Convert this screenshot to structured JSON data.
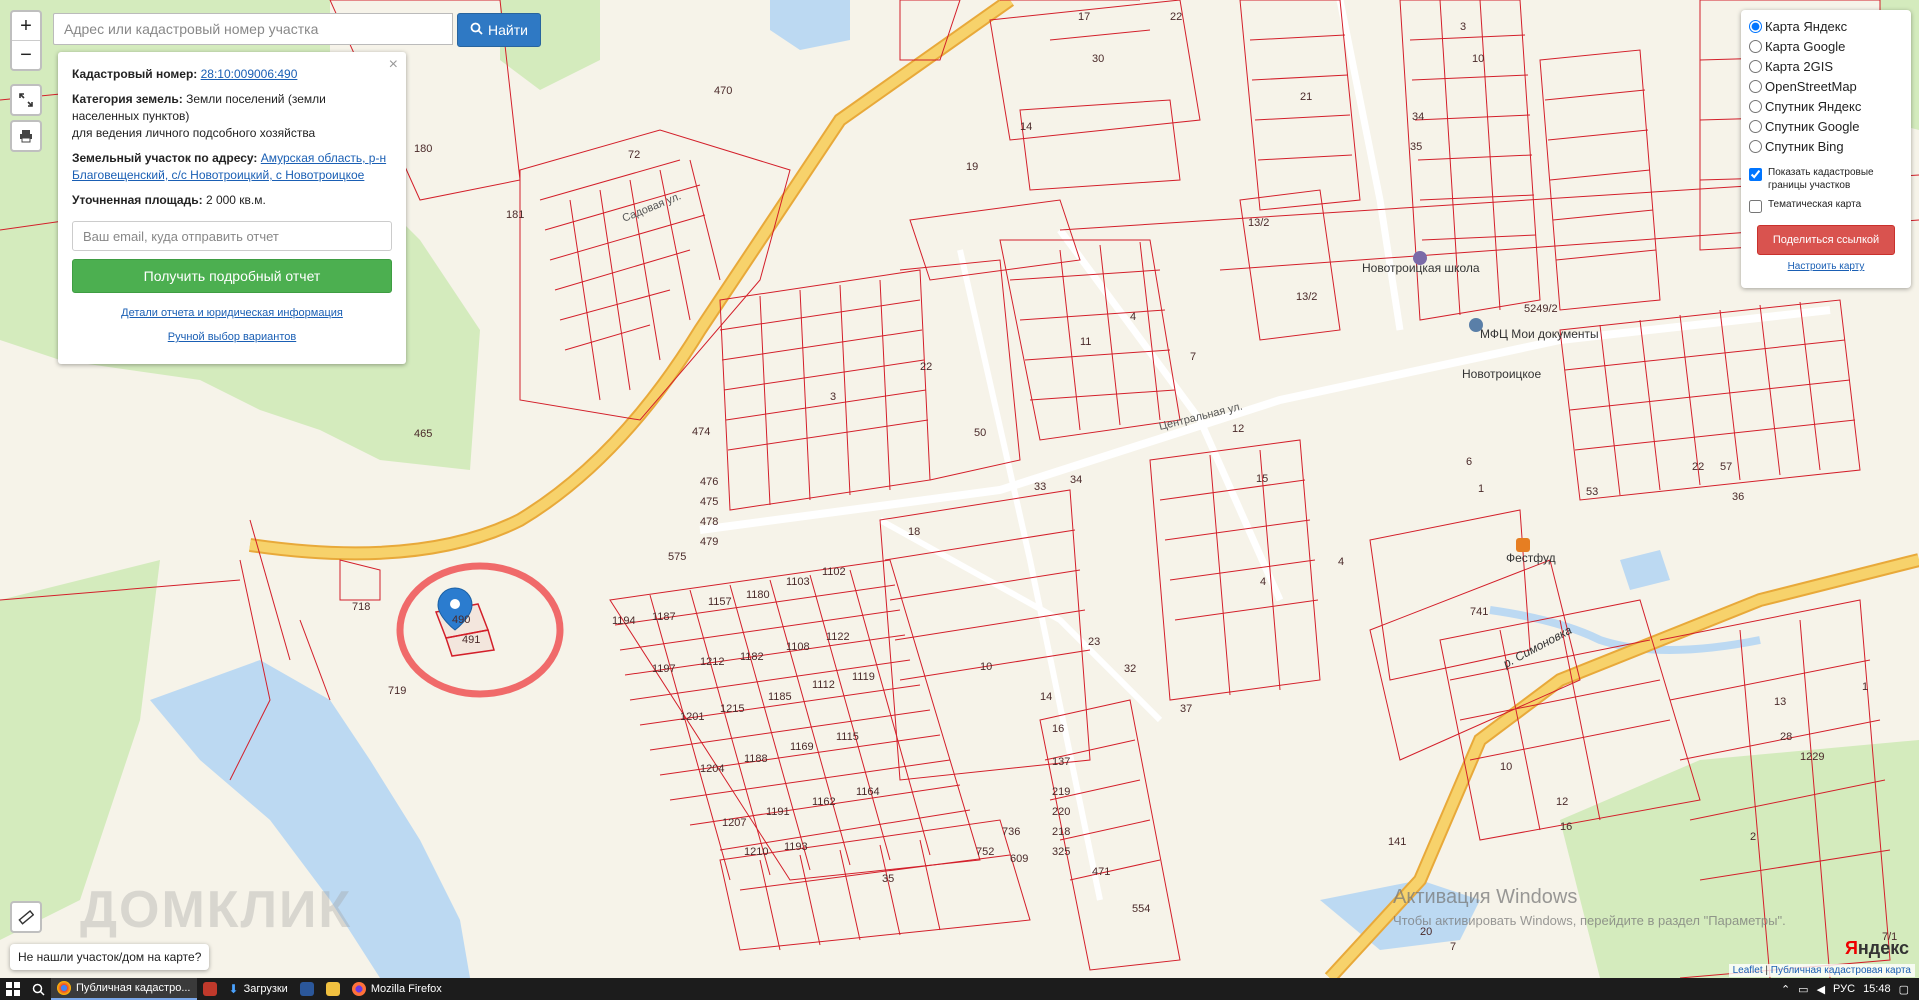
{
  "search": {
    "placeholder": "Адрес или кадастровый номер участка",
    "button_label": "Найти"
  },
  "controls": {
    "zoom_in": "+",
    "zoom_out": "−"
  },
  "info_panel": {
    "cadastral_label": "Кадастровый номер:",
    "cadastral_value": "28:10:009006:490",
    "category_label": "Категория земель:",
    "category_value": "Земли поселений (земли населенных пунктов)",
    "category_use": "для ведения личного подсобного хозяйства",
    "address_label": "Земельный участок по адресу:",
    "address_value": "Амурская область, р-н Благовещенский, с/с Новотроицкий, с Новотроицкое",
    "area_label": "Уточненная площадь:",
    "area_value": "2 000 кв.м.",
    "email_placeholder": "Ваш email, куда отправить отчет",
    "report_button": "Получить подробный отчет",
    "details_link": "Детали отчета и юридическая информация",
    "manual_link": "Ручной выбор вариантов"
  },
  "layers": {
    "options": [
      "Карта Яндекс",
      "Карта Google",
      "Карта 2GIS",
      "OpenStreetMap",
      "Спутник Яндекс",
      "Спутник Google",
      "Спутник Bing"
    ],
    "selected": "Карта Яндекс",
    "show_boundaries": "Показать кадастровые границы участков",
    "thematic": "Тематическая карта",
    "share_button": "Поделиться ссылкой",
    "configure_link": "Настроить карту"
  },
  "map": {
    "places": {
      "school": "Новотроицкая школа",
      "mfc": "МФЦ Мои документы",
      "village": "Новотроицкое",
      "store": "Фестфуд",
      "river": "р. Симоновка"
    },
    "streets": {
      "central": "Центральная ул.",
      "sadovaya": "Садовая ул."
    },
    "highlight_parcels": [
      "490",
      "491"
    ],
    "colors": {
      "parcel": "#d31f2a",
      "road": "#f7c65a",
      "green": "#cfe9b6",
      "water": "#bcd9f2"
    }
  },
  "bottom": {
    "not_found": "Не нашли участок/дом на карте?",
    "watermark": "ДОМКЛИК",
    "attribution_leaflet": "Leaflet",
    "attribution_pkk": "Публичная кадастровая карта",
    "yandex_logo_red": "Я",
    "yandex_logo_rest": "ндекс",
    "windows_activate_title": "Активация Windows",
    "windows_activate_text": "Чтобы активировать Windows, перейдите в раздел \"Параметры\"."
  },
  "taskbar": {
    "tabs": [
      "Публичная кадастро...",
      "Загрузки",
      "Mozilla Firefox"
    ],
    "lang": "РУС",
    "time": "15:48"
  }
}
